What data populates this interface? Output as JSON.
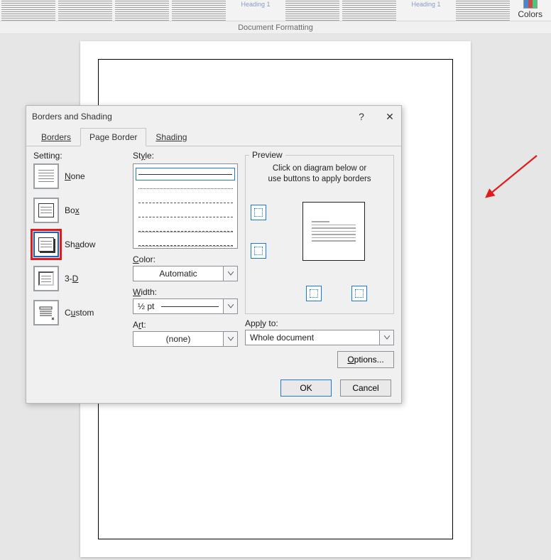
{
  "ribbon": {
    "group_label": "Document Formatting",
    "colors_label": "Colors"
  },
  "dialog": {
    "title": "Borders and Shading",
    "tabs": {
      "borders": "Borders",
      "page_border": "Page Border",
      "shading": "Shading"
    },
    "setting": {
      "label": "Setting:",
      "none": "None",
      "box": "Box",
      "shadow": "Shadow",
      "three_d": "3-D",
      "custom": "Custom"
    },
    "style": {
      "label": "Style:",
      "color_label": "Color:",
      "color_value": "Automatic",
      "width_label": "Width:",
      "width_value": "½ pt",
      "art_label": "Art:",
      "art_value": "(none)"
    },
    "preview": {
      "legend": "Preview",
      "hint_line1": "Click on diagram below or",
      "hint_line2": "use buttons to apply borders",
      "apply_label": "Apply to:",
      "apply_value": "Whole document",
      "options_btn": "Options..."
    },
    "buttons": {
      "ok": "OK",
      "cancel": "Cancel"
    }
  }
}
